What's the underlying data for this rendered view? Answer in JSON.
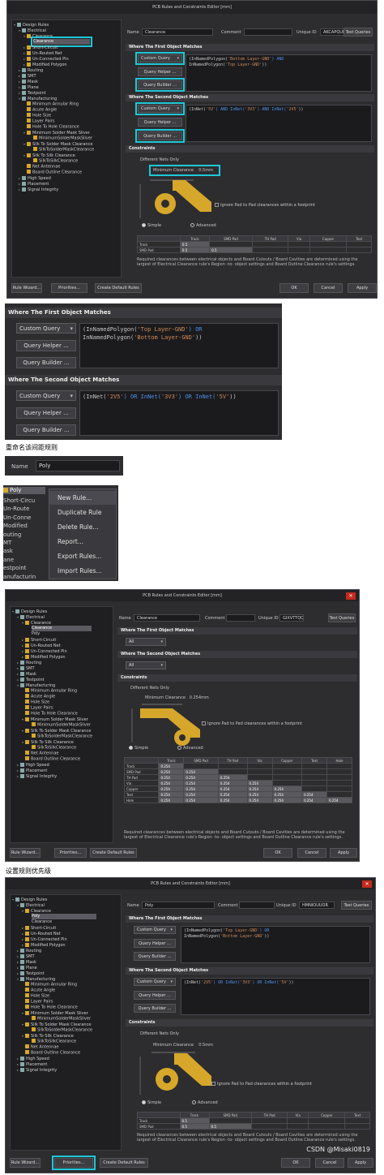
{
  "win1": {
    "title": "PCB Rules and Constraints Editor [mm]",
    "name_label": "Name",
    "name_value": "Clearance",
    "comment_label": "Comment",
    "uid_label": "Unique ID",
    "uid_value": "AKCAPQUE",
    "test_queries": "Test Queries",
    "first_match_header": "Where The First Object Matches",
    "second_match_header": "Where The Second Object Matches",
    "custom_query": "Custom Query",
    "query_helper": "Query Helper ...",
    "query_builder": "Query Builder ...",
    "first_query_line1_a": "(InNamedPolygon(",
    "first_query_line1_s": "'Bottom Layer-GND'",
    "first_query_line1_b": ") AND",
    "first_query_line2_a": "InNamedPolygon(",
    "first_query_line2_s": "'Top Layer-GND'",
    "first_query_line2_b": "))",
    "second_query_a": "(InNet(",
    "second_query_s1": "'5V'",
    "second_query_and1": ") AND InNet(",
    "second_query_s2": "'3V3'",
    "second_query_and2": ") AND InNet(",
    "second_query_s3": "'2V5'",
    "second_query_end": "))",
    "constraints_header": "Constraints",
    "different_nets": "Different Nets Only",
    "min_clearance_label": "Minimum Clearance",
    "min_clearance_value": "0.5mm",
    "ignore_pad": "Ignore Pad to Pad clearances within a footprint",
    "simple": "Simple",
    "advanced": "Advanced",
    "grid_cols": [
      "",
      "Track",
      "SMD Pad",
      "TH Pad",
      "Via",
      "Copper",
      "Text"
    ],
    "grid_rows": [
      [
        "Track",
        "0.5",
        "",
        "",
        "",
        "",
        ""
      ],
      [
        "SMD Pad",
        "0.5",
        "0.5",
        "",
        "",
        "",
        ""
      ]
    ],
    "desc": "Required clearances between electrical objects and Board Cutouts / Board Cavities are determined using the largest of Electrical Clearance rule's Region -to- object settings and Board Outline Clearance rule's settings.",
    "rule_wizard": "Rule Wizard...",
    "priorities": "Priorities...",
    "create_default": "Create Default Rules",
    "ok": "OK",
    "cancel": "Cancel",
    "apply": "Apply"
  },
  "tree": {
    "design_rules": "Design Rules",
    "electrical": "Electrical",
    "clearance_group": "Clearance",
    "clearance": "Clearance",
    "poly": "Poly",
    "short_circuit": "Short-Circuit",
    "unrouted_net": "Un-Routed Net",
    "unconnected_pin": "Un-Connected Pin",
    "modified_polygon": "Modified Polygon",
    "routing": "Routing",
    "smt": "SMT",
    "mask": "Mask",
    "plane": "Plane",
    "testpoint": "Testpoint",
    "manufacturing": "Manufacturing",
    "min_annular": "Minimum Annular Ring",
    "acute_angle": "Acute Angle",
    "hole_size": "Hole Size",
    "layer_pairs": "Layer Pairs",
    "hole_to_hole": "Hole To Hole Clearance",
    "min_solder_sliver": "Minimum Solder Mask Sliver",
    "min_solder_sliver_item": "MinimumSolderMaskSliver",
    "silk_to_solder": "Silk To Solder Mask Clearance",
    "silk_to_solder_item": "SilkToSolderMaskClearance",
    "silk_to_silk": "Silk To Silk Clearance",
    "silk_to_silk_item": "SilkToSilkClearance",
    "net_antennae": "Net Antennae",
    "board_outline": "Board Outline Clearance",
    "high_speed": "High Speed",
    "placement": "Placement",
    "signal_integrity": "Signal Integrity"
  },
  "zoom1": {
    "first_header": "Where The First Object Matches",
    "custom_query": "Custom Query",
    "query_helper": "Query Helper ...",
    "query_builder": "Query Builder ...",
    "q1_a": "(InNamedPolygon(",
    "q1_s": "'Top Layer-GND'",
    "q1_b": ") OR",
    "q2_a": "InNamedPolygon(",
    "q2_s": "'Bottom Layer-GND'",
    "q2_b": "))",
    "second_header": "Where The Second Object Matches",
    "s_a": "(InNet(",
    "s_s1": "'2V5'",
    "s_or1": ") OR InNet(",
    "s_s2": "'3V3'",
    "s_or2": ") OR InNet(",
    "s_s3": "'5V'",
    "s_end": "))"
  },
  "caption_rename": "重命名该间距规则",
  "rename": {
    "name_label": "Name",
    "name_value": "Poly"
  },
  "context": {
    "poly": "Poly",
    "bg_items": [
      "Short-Circu",
      "Un-Route",
      "Un-Conne",
      "Modified",
      "outing",
      "MT",
      "ask",
      "ane",
      "estpoint",
      "anufacturin"
    ],
    "menu_items": [
      "New Rule...",
      "Duplicate Rule",
      "Delete Rule...",
      "Report...",
      "Export Rules...",
      "Import Rules..."
    ]
  },
  "win2": {
    "title": "PCB Rules and Constraints Editor [mm]",
    "name_label": "Name",
    "name_value": "Clearance",
    "comment_label": "Comment",
    "uid_label": "Unique ID",
    "uid_value": "GIXVTTQQ",
    "test_queries": "Test Queries",
    "first_header": "Where The First Object Matches",
    "second_header": "Where The Second Object Matches",
    "all": "All",
    "constraints_header": "Constraints",
    "different_nets": "Different Nets Only",
    "min_clearance_label": "Minimum Clearance",
    "min_clearance_value": "0.254mm",
    "ignore_pad": "Ignore Pad to Pad clearances within a footprint",
    "simple": "Simple",
    "advanced": "Advanced",
    "grid_cols": [
      "",
      "Track",
      "SMD Pad",
      "TH Pad",
      "Via",
      "Copper",
      "Text",
      "Hole"
    ],
    "grid_rows": [
      [
        "Track",
        "0.254",
        "",
        "",
        "",
        "",
        "",
        ""
      ],
      [
        "SMD Pad",
        "0.254",
        "0.254",
        "",
        "",
        "",
        "",
        ""
      ],
      [
        "TH Pad",
        "0.254",
        "0.254",
        "0.254",
        "",
        "",
        "",
        ""
      ],
      [
        "Via",
        "0.254",
        "0.254",
        "0.254",
        "0.254",
        "",
        "",
        ""
      ],
      [
        "Copper",
        "0.254",
        "0.254",
        "0.254",
        "0.254",
        "0.254",
        "",
        ""
      ],
      [
        "Text",
        "0.254",
        "0.254",
        "0.254",
        "0.254",
        "0.254",
        "0.254",
        ""
      ],
      [
        "Hole",
        "0.254",
        "0.254",
        "0.254",
        "0.254",
        "0.254",
        "0.254",
        "0.254"
      ]
    ],
    "desc": "Required clearances between electrical objects and Board Cutouts / Board Cavities are determined using the largest of Electrical Clearance rule's Region -to- object settings and Board Outline Clearance rule's settings.",
    "rule_wizard": "Rule Wizard...",
    "priorities": "Priorities...",
    "create_default": "Create Default Rules",
    "ok": "OK",
    "cancel": "Cancel",
    "apply": "Apply"
  },
  "caption_priority": "设置规则优先级",
  "win3": {
    "title": "PCB Rules and Constraints Editor [mm]",
    "name_label": "Name",
    "name_value": "Poly",
    "comment_label": "Comment",
    "uid_label": "Unique ID",
    "uid_value": "HMNIOUUOR",
    "test_queries": "Test Queries",
    "first_header": "Where The First Object Matches",
    "second_header": "Where The Second Object Matches",
    "custom_query": "Custom Query",
    "query_helper": "Query Helper ...",
    "query_builder": "Query Builder ...",
    "constraints_header": "Constraints",
    "different_nets": "Different Nets Only",
    "min_clearance_label": "Minimum Clearance",
    "min_clearance_value": "0.5mm",
    "ignore_pad": "Ignore Pad to Pad clearances within a footprint",
    "simple": "Simple",
    "advanced": "Advanced",
    "grid_cols": [
      "",
      "Track",
      "SMD Pad",
      "TH Pad",
      "Via",
      "Copper",
      "Text"
    ],
    "grid_rows": [
      [
        "Track",
        "0.5",
        "",
        "",
        "",
        "",
        ""
      ],
      [
        "SMD Pad",
        "0.5",
        "0.5",
        "",
        "",
        "",
        ""
      ]
    ],
    "desc": "Required clearances between electrical objects and Board Cutouts / Board Cavities are determined using the largest of Electrical Clearance rule's Region -to- object settings and Board Outline Clearance rule's settings.",
    "rule_wizard": "Rule Wizard...",
    "priorities": "Priorities...",
    "create_default": "Create Default Rules",
    "ok": "OK",
    "cancel": "Cancel",
    "apply": "Apply"
  },
  "watermark": "CSDN @Misaki0819",
  "colors": {
    "highlight": "#1ec8d8",
    "close": "#c42b1c",
    "keyword": "#4d8ee8",
    "string": "#d08a55",
    "pad": "#d6a72a"
  }
}
